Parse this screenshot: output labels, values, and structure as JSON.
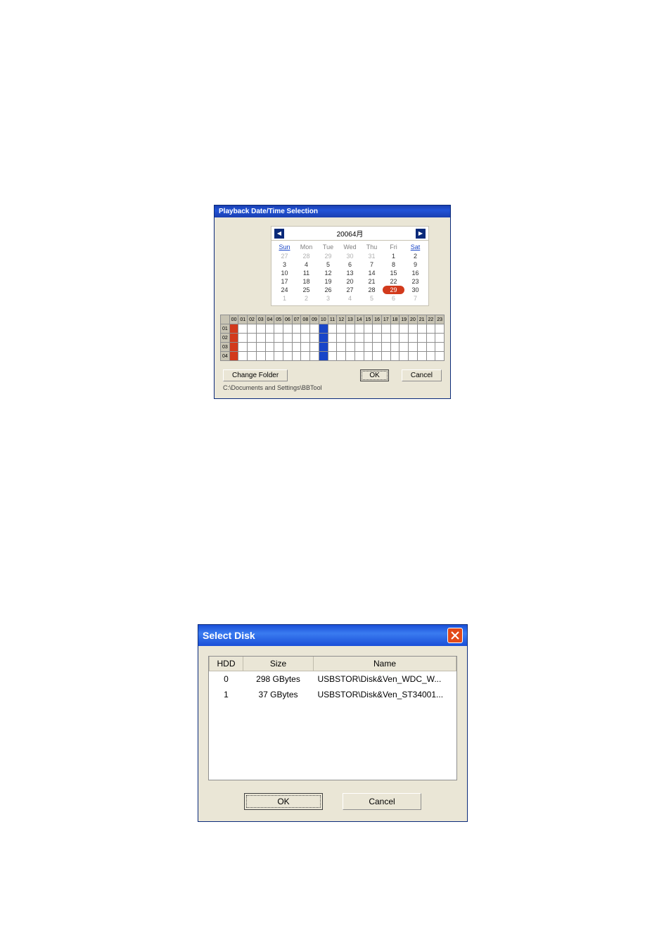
{
  "playback": {
    "title": "Playback Date/Time Selection",
    "calendar": {
      "month_label": "20064月",
      "prev_glyph": "◀",
      "next_glyph": "▶",
      "headers": [
        "Sun",
        "Mon",
        "Tue",
        "Wed",
        "Thu",
        "Fri",
        "Sat"
      ],
      "weeks": [
        [
          {
            "d": "27",
            "o": true
          },
          {
            "d": "28",
            "o": true
          },
          {
            "d": "29",
            "o": true
          },
          {
            "d": "30",
            "o": true
          },
          {
            "d": "31",
            "o": true
          },
          {
            "d": "1"
          },
          {
            "d": "2"
          }
        ],
        [
          {
            "d": "3"
          },
          {
            "d": "4"
          },
          {
            "d": "5"
          },
          {
            "d": "6"
          },
          {
            "d": "7"
          },
          {
            "d": "8"
          },
          {
            "d": "9"
          }
        ],
        [
          {
            "d": "10"
          },
          {
            "d": "11"
          },
          {
            "d": "12"
          },
          {
            "d": "13"
          },
          {
            "d": "14"
          },
          {
            "d": "15"
          },
          {
            "d": "16"
          }
        ],
        [
          {
            "d": "17"
          },
          {
            "d": "18"
          },
          {
            "d": "19"
          },
          {
            "d": "20"
          },
          {
            "d": "21"
          },
          {
            "d": "22"
          },
          {
            "d": "23"
          }
        ],
        [
          {
            "d": "24"
          },
          {
            "d": "25"
          },
          {
            "d": "26"
          },
          {
            "d": "27"
          },
          {
            "d": "28"
          },
          {
            "d": "29",
            "today": true
          },
          {
            "d": "30"
          }
        ],
        [
          {
            "d": "1",
            "o": true
          },
          {
            "d": "2",
            "o": true
          },
          {
            "d": "3",
            "o": true
          },
          {
            "d": "4",
            "o": true
          },
          {
            "d": "5",
            "o": true
          },
          {
            "d": "6",
            "o": true
          },
          {
            "d": "7",
            "o": true
          }
        ]
      ]
    },
    "timeline": {
      "hours": [
        "00",
        "01",
        "02",
        "03",
        "04",
        "05",
        "06",
        "07",
        "08",
        "09",
        "10",
        "11",
        "12",
        "13",
        "14",
        "15",
        "16",
        "17",
        "18",
        "19",
        "20",
        "21",
        "22",
        "23"
      ],
      "rows": [
        {
          "label": "01",
          "marks": {
            "0": "red",
            "10": "blue"
          }
        },
        {
          "label": "02",
          "marks": {
            "0": "red",
            "10": "blue"
          }
        },
        {
          "label": "03",
          "marks": {
            "0": "red",
            "10": "blue"
          }
        },
        {
          "label": "04",
          "marks": {
            "0": "red",
            "10": "blue"
          }
        }
      ]
    },
    "change_folder_label": "Change Folder",
    "ok_label": "OK",
    "cancel_label": "Cancel",
    "path": "C:\\Documents and Settings\\BBTool"
  },
  "select_disk": {
    "title": "Select Disk",
    "columns": {
      "hdd": "HDD",
      "size": "Size",
      "name": "Name"
    },
    "rows": [
      {
        "hdd": "0",
        "size": "298 GBytes",
        "name": "USBSTOR\\Disk&Ven_WDC_W..."
      },
      {
        "hdd": "1",
        "size": "37 GBytes",
        "name": "USBSTOR\\Disk&Ven_ST34001..."
      }
    ],
    "empty_rows": 5,
    "ok_label": "OK",
    "cancel_label": "Cancel"
  }
}
